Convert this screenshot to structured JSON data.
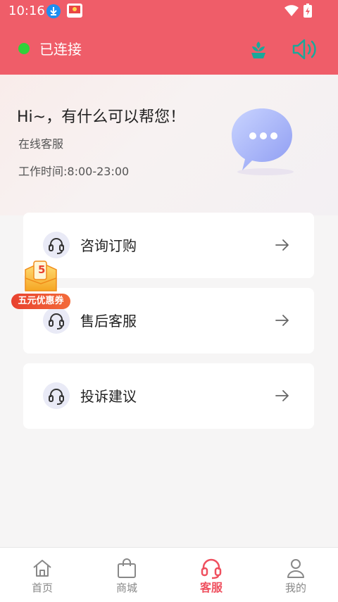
{
  "status_bar": {
    "time": "10:16",
    "icons": [
      "download-icon",
      "app-notification-icon",
      "wifi-icon",
      "battery-charging-icon"
    ]
  },
  "header": {
    "connection_status": "已连接",
    "status_color": "#2fd13a",
    "accent_color": "#ef5d69",
    "actions": [
      "flower-icon",
      "speaker-icon"
    ]
  },
  "hero": {
    "greeting": "Hi~，有什么可以帮您！",
    "subtitle": "在线客服",
    "hours": "工作时间:8:00-23:00",
    "illustration": "chat-bubble-icon"
  },
  "services": [
    {
      "label": "咨询订购",
      "icon": "headset-icon"
    },
    {
      "label": "售后客服",
      "icon": "headset-icon"
    },
    {
      "label": "投诉建议",
      "icon": "headset-icon"
    }
  ],
  "coupon": {
    "badge_number": "5",
    "label": "五元优惠券"
  },
  "bottom_nav": {
    "items": [
      {
        "label": "首页",
        "icon": "home-icon"
      },
      {
        "label": "商城",
        "icon": "shopping-bag-icon"
      },
      {
        "label": "客服",
        "icon": "headset-icon",
        "active": true
      },
      {
        "label": "我的",
        "icon": "user-icon"
      }
    ],
    "active_color": "#ef4f5e"
  }
}
